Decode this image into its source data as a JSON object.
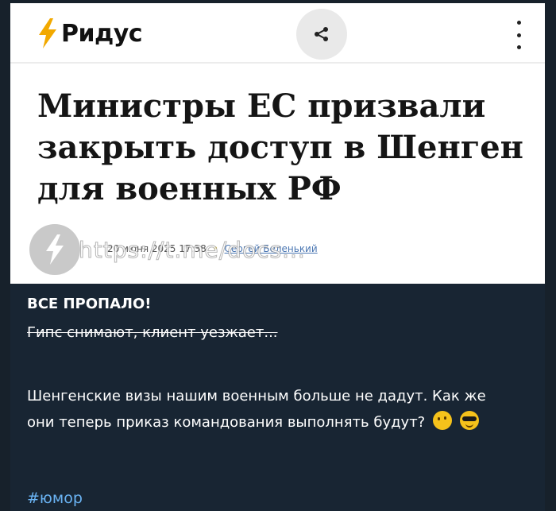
{
  "card": {
    "logo_text": "Ридус",
    "headline": "Министры ЕС призвали закрыть доступ в Шенген для военных РФ",
    "date": "20 июня 2025 17:38",
    "author": "Сергей Беленький",
    "watermark": "https://t.me/docs..."
  },
  "message": {
    "line1": "ВСЕ ПРОПАЛО!",
    "line2": "Гипс снимают, клиент уезжает...",
    "paragraph": "Шенгенские визы нашим военным больше не дадут. Как же они теперь приказ командования выполнять будут?",
    "emojis": [
      "thinking-face",
      "smiling-face-with-sunglasses"
    ],
    "hashtag": "#юмор"
  },
  "colors": {
    "chat_background": "#17212b",
    "link": "#6ab3f3",
    "author_link": "#4a76b2",
    "logo_bolt": "#f2a900"
  }
}
